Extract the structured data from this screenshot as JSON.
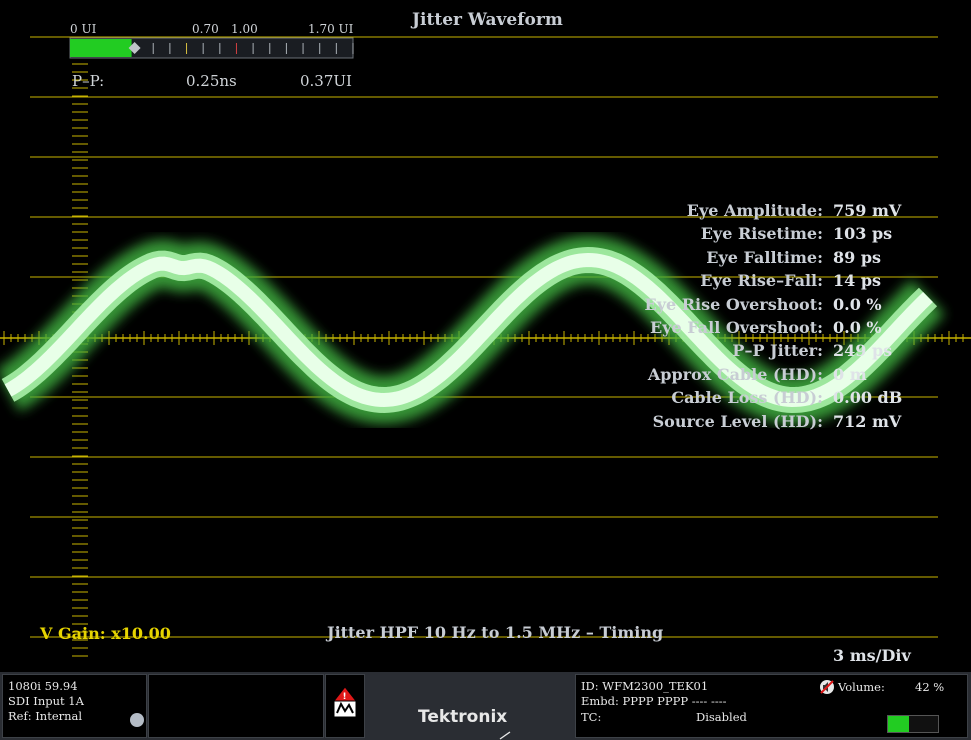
{
  "title": "Jitter Waveform",
  "jitter_scale": {
    "labels": [
      "0 UI",
      "0.70",
      "1.00",
      "1.70 UI"
    ],
    "bar_fraction": 0.37,
    "pp_label": "P–P:",
    "pp_ns": "0.25ns",
    "pp_ui": "0.37UI"
  },
  "measurements": [
    {
      "label": "Eye Amplitude:",
      "value": "759 mV"
    },
    {
      "label": "Eye Risetime:",
      "value": "103 ps"
    },
    {
      "label": "Eye Falltime:",
      "value": "89 ps"
    },
    {
      "label": "Eye Rise–Fall:",
      "value": "14 ps"
    },
    {
      "label": "Eye Rise Overshoot:",
      "value": "0.0 %"
    },
    {
      "label": "Eye Fall Overshoot:",
      "value": "0.0 %"
    },
    {
      "label": "P–P Jitter:",
      "value": "249 ps"
    },
    {
      "label": "Approx Cable (HD):",
      "value": "0 m"
    },
    {
      "label": "Cable Loss (HD):",
      "value": "0.00 dB"
    },
    {
      "label": "Source Level (HD):",
      "value": "712 mV"
    }
  ],
  "v_gain": "V Gain: x10.00",
  "filter_label": "Jitter HPF 10 Hz to 1.5 MHz – Timing",
  "time_div": "3 ms/Div",
  "status": {
    "format": "1080i 59.94",
    "input": "SDI Input 1A",
    "ref": "Ref: Internal",
    "brand": "Tektronix",
    "id": "ID: WFM2300_TEK01",
    "embd": "Embd: PPPP PPPP ---- ----",
    "tc_label": "TC:",
    "tc_value": "Disabled",
    "volume_label": "Volume:",
    "volume_value": "42 %",
    "volume_fraction": 0.42
  },
  "colors": {
    "graticule": "#c8b400",
    "trace": "#e8ffe8",
    "trace_glow": "#3fae3f",
    "bar_green": "#22cc22",
    "vgain_text": "#e6d400"
  }
}
